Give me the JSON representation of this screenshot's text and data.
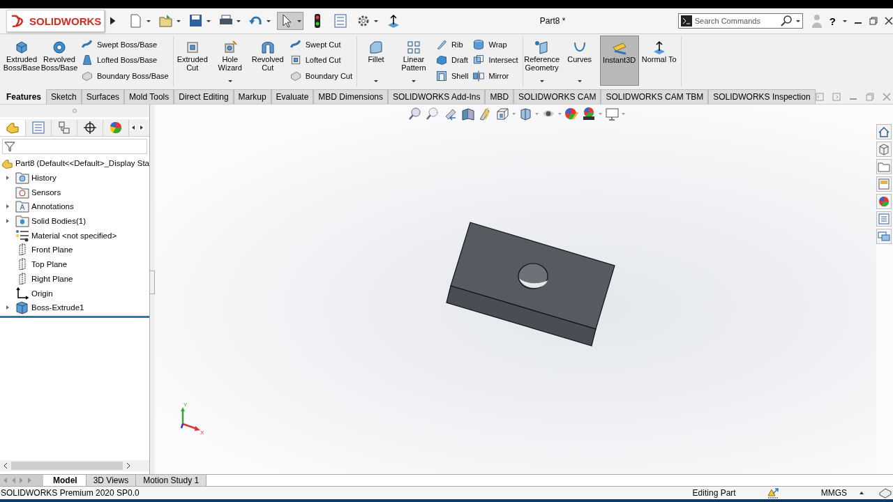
{
  "title_bar": {
    "logo_text": "SOLIDWORKS",
    "document_title": "Part8 *",
    "search": {
      "placeholder": "Search Commands"
    },
    "help": "?"
  },
  "ribbon": {
    "groups": [
      {
        "items": [
          {
            "kind": "large",
            "label": "Extruded Boss/Base",
            "dropdown": false,
            "selected": false
          },
          {
            "kind": "large",
            "label": "Revolved Boss/Base",
            "dropdown": false,
            "selected": false
          },
          {
            "kind": "column",
            "items": [
              "Swept Boss/Base",
              "Lofted Boss/Base",
              "Boundary Boss/Base"
            ]
          }
        ]
      },
      {
        "items": [
          {
            "kind": "large",
            "label": "Extruded Cut",
            "dropdown": false,
            "selected": false
          },
          {
            "kind": "large",
            "label": "Hole Wizard",
            "dropdown": true,
            "selected": false
          },
          {
            "kind": "large",
            "label": "Revolved Cut",
            "dropdown": false,
            "selected": false
          },
          {
            "kind": "column",
            "items": [
              "Swept Cut",
              "Lofted Cut",
              "Boundary Cut"
            ]
          }
        ]
      },
      {
        "items": [
          {
            "kind": "large",
            "label": "Fillet",
            "dropdown": true,
            "selected": false
          },
          {
            "kind": "large",
            "label": "Linear Pattern",
            "dropdown": true,
            "selected": false
          },
          {
            "kind": "column",
            "items": [
              "Rib",
              "Draft",
              "Shell"
            ]
          },
          {
            "kind": "column",
            "items": [
              "Wrap",
              "Intersect",
              "Mirror"
            ]
          }
        ]
      },
      {
        "items": [
          {
            "kind": "large",
            "label": "Reference Geometry",
            "dropdown": true,
            "selected": false
          },
          {
            "kind": "large",
            "label": "Curves",
            "dropdown": true,
            "selected": false
          },
          {
            "kind": "large",
            "label": "Instant3D",
            "dropdown": false,
            "selected": true
          },
          {
            "kind": "large",
            "label": "Normal To",
            "dropdown": false,
            "selected": false
          }
        ]
      }
    ]
  },
  "command_tabs": [
    {
      "label": "Features",
      "selected": true
    },
    {
      "label": "Sketch",
      "selected": false
    },
    {
      "label": "Surfaces",
      "selected": false
    },
    {
      "label": "Mold Tools",
      "selected": false
    },
    {
      "label": "Direct Editing",
      "selected": false
    },
    {
      "label": "Markup",
      "selected": false
    },
    {
      "label": "Evaluate",
      "selected": false
    },
    {
      "label": "MBD Dimensions",
      "selected": false
    },
    {
      "label": "SOLIDWORKS Add-Ins",
      "selected": false
    },
    {
      "label": "MBD",
      "selected": false
    },
    {
      "label": "SOLIDWORKS CAM",
      "selected": false
    },
    {
      "label": "SOLIDWORKS CAM TBM",
      "selected": false
    },
    {
      "label": "SOLIDWORKS Inspection",
      "selected": false
    }
  ],
  "feature_tree": {
    "root": "Part8  (Default<<Default>_Display Sta",
    "items": [
      {
        "label": "History",
        "kind": "folder",
        "expandable": true
      },
      {
        "label": "Sensors",
        "kind": "folder",
        "expandable": false
      },
      {
        "label": "Annotations",
        "kind": "folder",
        "expandable": true
      },
      {
        "label": "Solid Bodies(1)",
        "kind": "folder",
        "expandable": true
      },
      {
        "label": "Material <not specified>",
        "kind": "material",
        "expandable": false
      },
      {
        "label": "Front Plane",
        "kind": "plane",
        "expandable": false
      },
      {
        "label": "Top Plane",
        "kind": "plane",
        "expandable": false
      },
      {
        "label": "Right Plane",
        "kind": "plane",
        "expandable": false
      },
      {
        "label": "Origin",
        "kind": "origin",
        "expandable": false
      },
      {
        "label": "Boss-Extrude1",
        "kind": "feature",
        "expandable": true
      }
    ]
  },
  "viewport": {
    "triad": {
      "y_label": "Y",
      "x_label": "X"
    }
  },
  "bottom_tabs": [
    {
      "label": "Model",
      "selected": true
    },
    {
      "label": "3D Views",
      "selected": false
    },
    {
      "label": "Motion Study 1",
      "selected": false
    }
  ],
  "status_bar": {
    "product": "SOLIDWORKS Premium 2020 SP0.0",
    "mode": "Editing Part",
    "units": "MMGS"
  }
}
